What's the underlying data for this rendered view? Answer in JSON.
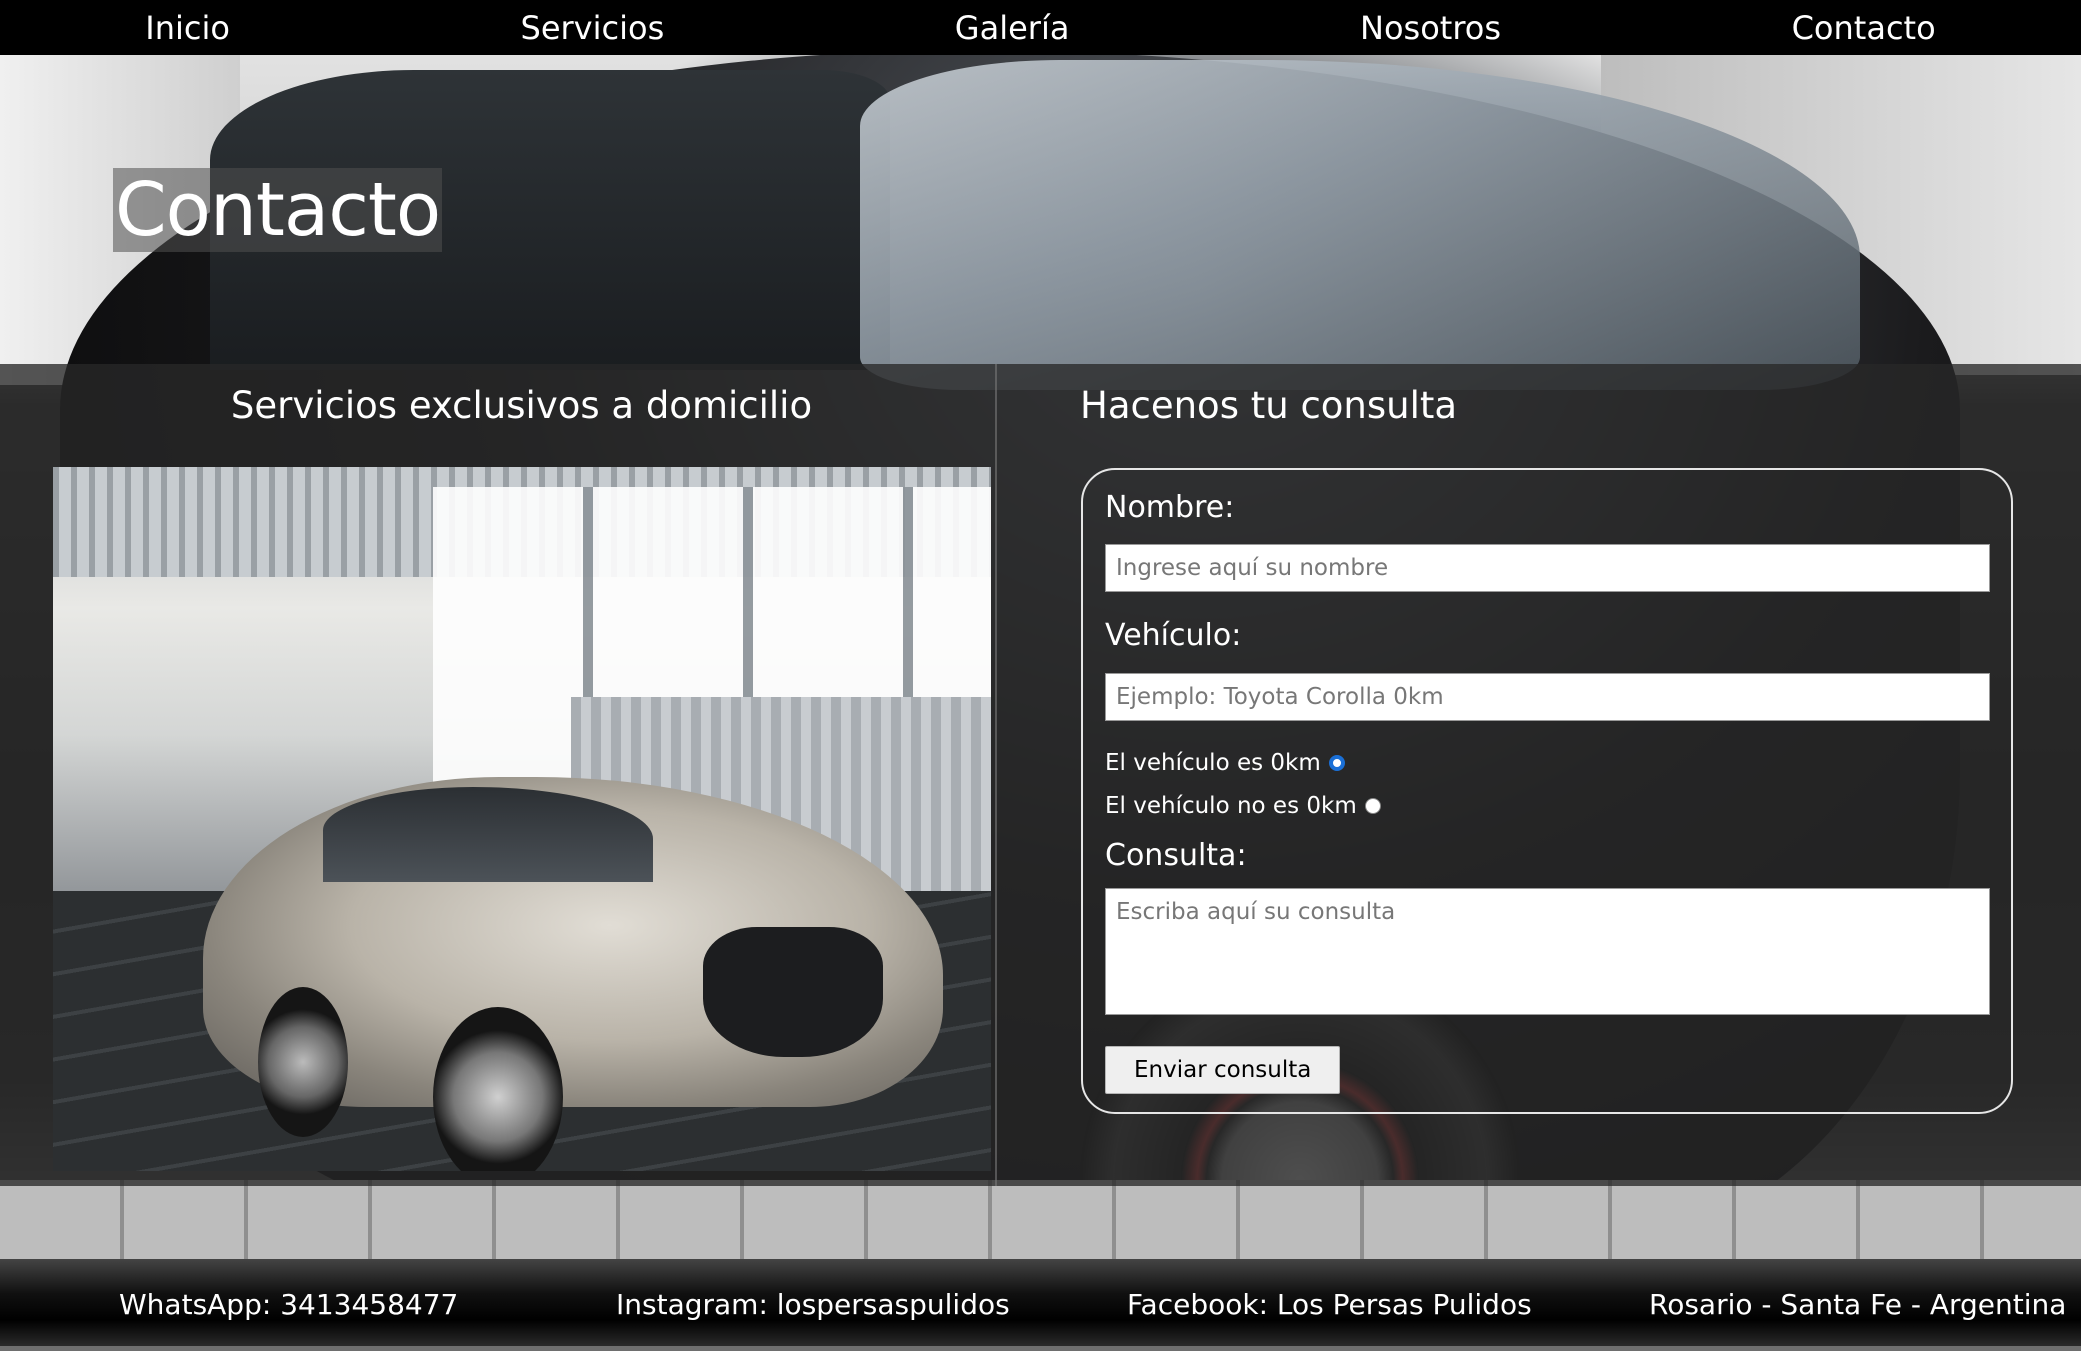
{
  "nav": {
    "items": [
      "Inicio",
      "Servicios",
      "Galería",
      "Nosotros",
      "Contacto"
    ]
  },
  "page_title": "Contacto",
  "left": {
    "title": "Servicios exclusivos a domicilio"
  },
  "form": {
    "title": "Hacenos tu consulta",
    "nombre_label": "Nombre:",
    "nombre_placeholder": "Ingrese aquí su nombre",
    "vehiculo_label": "Vehículo:",
    "vehiculo_placeholder": "Ejemplo: Toyota Corolla 0km",
    "radio_0km_label": "El vehículo es 0km",
    "radio_0km_checked": true,
    "radio_no0km_label": "El vehículo no es 0km",
    "radio_no0km_checked": false,
    "consulta_label": "Consulta:",
    "consulta_placeholder": "Escriba aquí su consulta",
    "submit_label": "Enviar consulta"
  },
  "footer": {
    "whatsapp": "WhatsApp: 3413458477",
    "instagram": "Instagram: lospersaspulidos",
    "facebook": "Facebook: Los Persas Pulidos",
    "location": "Rosario - Santa Fe - Argentina"
  },
  "colors": {
    "nav_bg": "#000000",
    "radio_accent": "#1a6fd6"
  }
}
